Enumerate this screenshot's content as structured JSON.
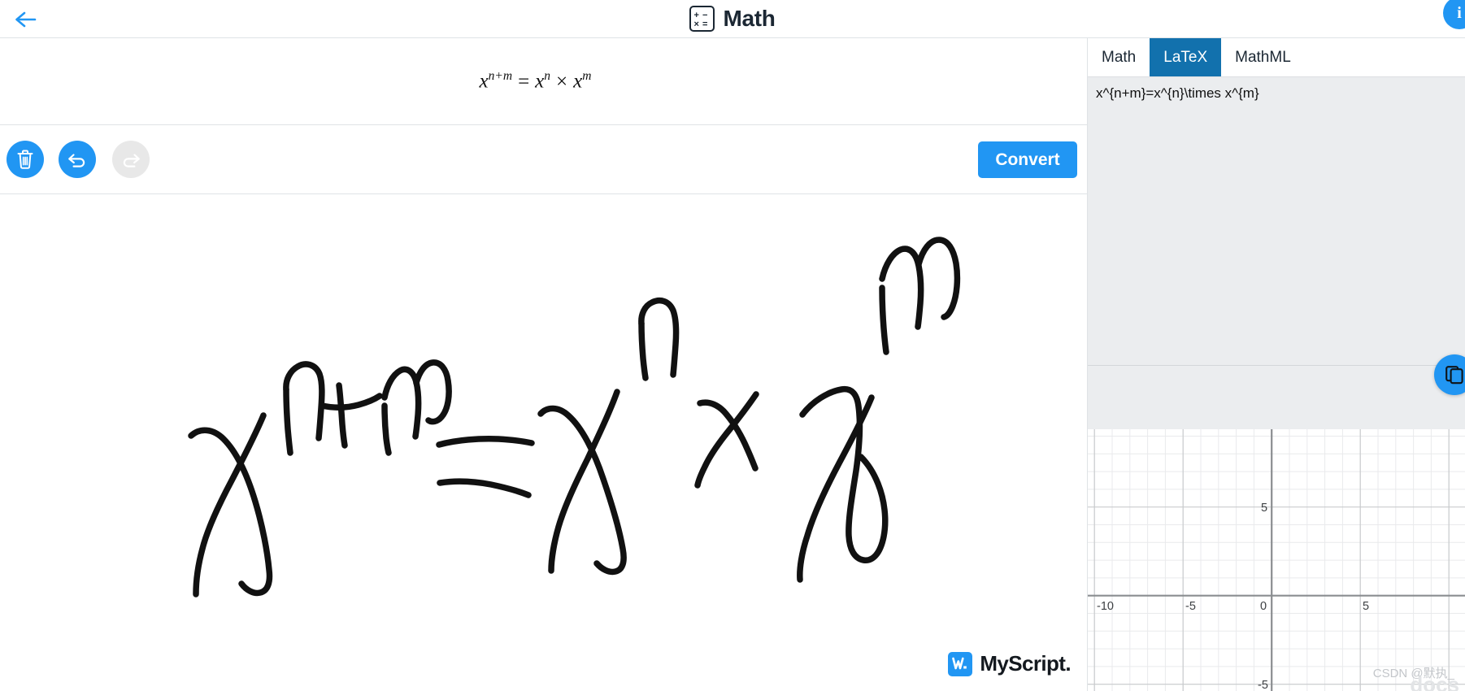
{
  "header": {
    "back_icon": "arrow-left-icon",
    "app_icon": "calculator-icon",
    "app_icon_glyphs": [
      "+",
      "−",
      "×",
      "="
    ],
    "title": "Math",
    "info_label": "i"
  },
  "result": {
    "base": "x",
    "exp_sum": "n+m",
    "equals": "=",
    "base2": "x",
    "exp_n": "n",
    "times": "×",
    "base3": "x",
    "exp_m": "m",
    "plain_text": "x^(n+m) = x^n × x^m"
  },
  "toolbar": {
    "clear_label": "Clear",
    "clear_icon": "trash-icon",
    "undo_label": "Undo",
    "undo_icon": "undo-arrow-icon",
    "redo_label": "Redo",
    "redo_icon": "redo-arrow-icon",
    "redo_disabled": true,
    "convert_label": "Convert",
    "accent_color": "#2196f3",
    "disabled_color": "#e8e8e8"
  },
  "canvas": {
    "ink_color": "#111111",
    "handwriting_text": "x^{n+m} = x^{n} × x^{m}",
    "brand_name": "MyScript.",
    "brand_mark": "W",
    "brand_color": "#2196f3"
  },
  "panel": {
    "tabs": [
      {
        "label": "Math",
        "active": false
      },
      {
        "label": "LaTeX",
        "active": true
      },
      {
        "label": "MathML",
        "active": false
      }
    ],
    "active_tab_color": "#1271ad",
    "latex_value": "x^{n+m}=x^{n}\\times x^{m}",
    "latex_placeholder": "",
    "copy_icon": "copy-icon",
    "copy_label": "Copy"
  },
  "chart_data": {
    "type": "line",
    "title": "",
    "xlabel": "",
    "ylabel": "",
    "xlim": [
      -11.2,
      8.4
    ],
    "ylim": [
      -7.6,
      7.0
    ],
    "x_ticks": [
      -10,
      -5,
      0,
      5
    ],
    "x_tick_labels": [
      "-10",
      "-5",
      "0",
      "5"
    ],
    "y_ticks": [
      5,
      -5
    ],
    "y_tick_labels": [
      "5",
      "-5"
    ],
    "minor_grid_step": 1,
    "major_grid_step": 5,
    "grid": true,
    "legend": "none",
    "series": [],
    "axis_color": "#8a8d90",
    "minor_grid_color": "#e6e7e8",
    "major_grid_color": "#c9cbcd"
  },
  "watermark": {
    "text": "CSDN @默执_",
    "ghost": "docs"
  }
}
